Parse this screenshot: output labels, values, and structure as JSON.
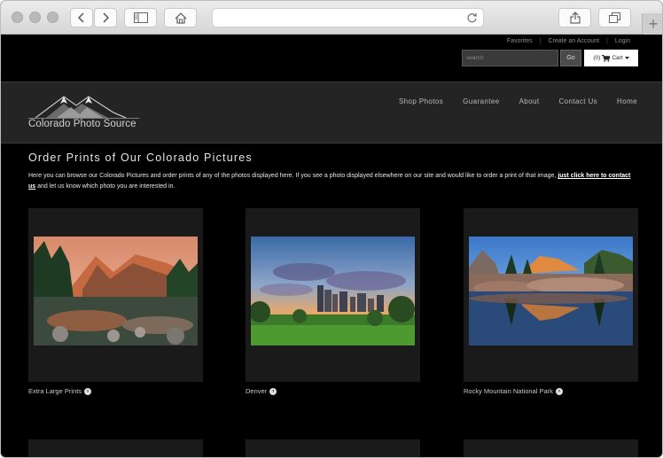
{
  "browser": {
    "icons": {
      "back": "chevron-left-icon",
      "forward": "chevron-right-icon",
      "sidebar": "sidebar-icon",
      "home": "home-icon",
      "reload": "reload-icon",
      "share": "share-icon",
      "tabs": "tabs-icon",
      "new_tab": "plus-icon"
    },
    "new_tab_label": "+"
  },
  "utility": {
    "favorites": "Favorites",
    "create_account": "Create an Account",
    "login": "Login"
  },
  "search": {
    "placeholder": "search",
    "go_label": "Go"
  },
  "cart": {
    "count": "(0)",
    "label": "Cart"
  },
  "logo": {
    "text": "Colorado Photo Source"
  },
  "nav": {
    "items": [
      "Shop Photos",
      "Guarantee",
      "About",
      "Contact Us",
      "Home"
    ]
  },
  "page": {
    "title": "Order Prints of Our Colorado Pictures",
    "intro_text": "Here you can browse our Colorado Pictures and order prints of any of the photos displayed here. If you see a photo displayed elsewhere on our site and would like to order a print of that image,",
    "intro_link": "just click here to contact us",
    "intro_tail": "and let us know which photo you are interested in."
  },
  "galleries": [
    {
      "caption": "Extra Large Prints"
    },
    {
      "caption": "Denver"
    },
    {
      "caption": "Rocky Mountain National Park"
    }
  ],
  "colors": {
    "page_bg": "#000000",
    "header_bg": "#242424",
    "card_bg": "#1a1a1a",
    "text": "#e6e6e6"
  }
}
